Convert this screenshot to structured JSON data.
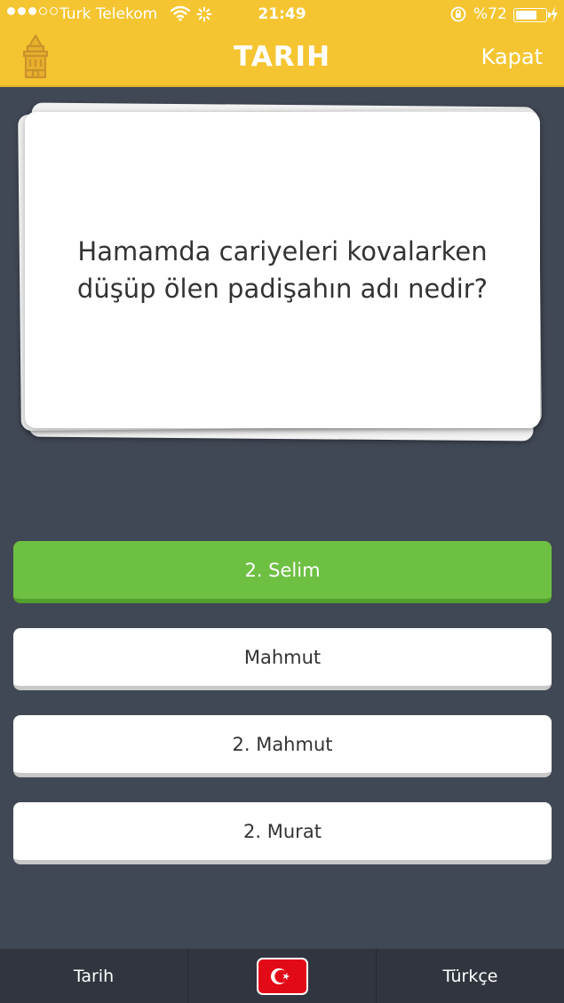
{
  "status_bar": {
    "carrier": "Turk Telekom",
    "time": "21:49",
    "battery_percent": "%72",
    "battery_level": 0.72,
    "signal_bars_filled": 3,
    "signal_bars_total": 5,
    "icons": [
      "wifi-icon",
      "activity-icon",
      "rotation-lock-icon",
      "battery-icon",
      "charging-icon"
    ]
  },
  "nav": {
    "title": "TARIH",
    "close_label": "Kapat",
    "topic_icon": "galata-tower-icon"
  },
  "question": {
    "text": "Hamamda cariyeleri kovalarken düşüp ölen padişahın adı nedir?"
  },
  "answers": [
    {
      "label": "2. Selim",
      "state": "correct"
    },
    {
      "label": "Mahmut",
      "state": "default"
    },
    {
      "label": "2. Mahmut",
      "state": "default"
    },
    {
      "label": "2. Murat",
      "state": "default"
    }
  ],
  "bottom_bar": {
    "left_label": "Tarih",
    "center_icon": "turkey-flag-icon",
    "right_label": "Türkçe"
  },
  "colors": {
    "header": "#f5c531",
    "background": "#414855",
    "correct": "#6ec043",
    "bottom_bar": "#30353f",
    "flag_red": "#e30a17"
  }
}
